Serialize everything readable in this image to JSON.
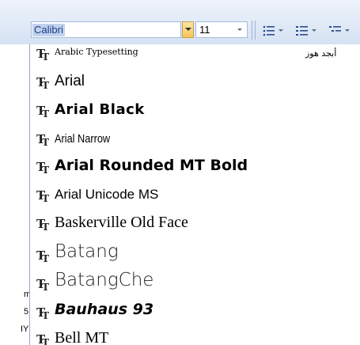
{
  "ribbon": {
    "font_name_value": "Calibri",
    "font_size_value": "11",
    "bullets_icon": "bullet-list-icon",
    "numbering_icon": "numbered-list-icon",
    "multilevel_icon": "multilevel-list-icon"
  },
  "font_list": {
    "items": [
      {
        "label": "Arabic Typesetting",
        "icon": "truetype-font-icon"
      },
      {
        "label": "Arial",
        "icon": "truetype-font-icon"
      },
      {
        "label": "Arial Black",
        "icon": "truetype-font-icon"
      },
      {
        "label": "Arial Narrow",
        "icon": "truetype-font-icon"
      },
      {
        "label": "Arial Rounded MT Bold",
        "icon": "truetype-font-icon"
      },
      {
        "label": "Arial Unicode MS",
        "icon": "truetype-font-icon"
      },
      {
        "label": "Baskerville Old Face",
        "icon": "truetype-font-icon"
      },
      {
        "label": "Batang",
        "icon": "truetype-font-icon"
      },
      {
        "label": "BatangChe",
        "icon": "truetype-font-icon"
      },
      {
        "label": "Bauhaus 93",
        "icon": "truetype-font-icon"
      },
      {
        "label": "Bell MT",
        "icon": "truetype-font-icon"
      }
    ],
    "arabic_preview": "أبجد هوز"
  },
  "background_scraps": {
    "left_chars": [
      "m",
      "5",
      "IY"
    ]
  },
  "colors": {
    "ribbon_top": "#eef3fb",
    "ribbon_bottom": "#d5e2f3",
    "selection": "#c1d2ee",
    "dropdown_button": "#f6c45a"
  }
}
